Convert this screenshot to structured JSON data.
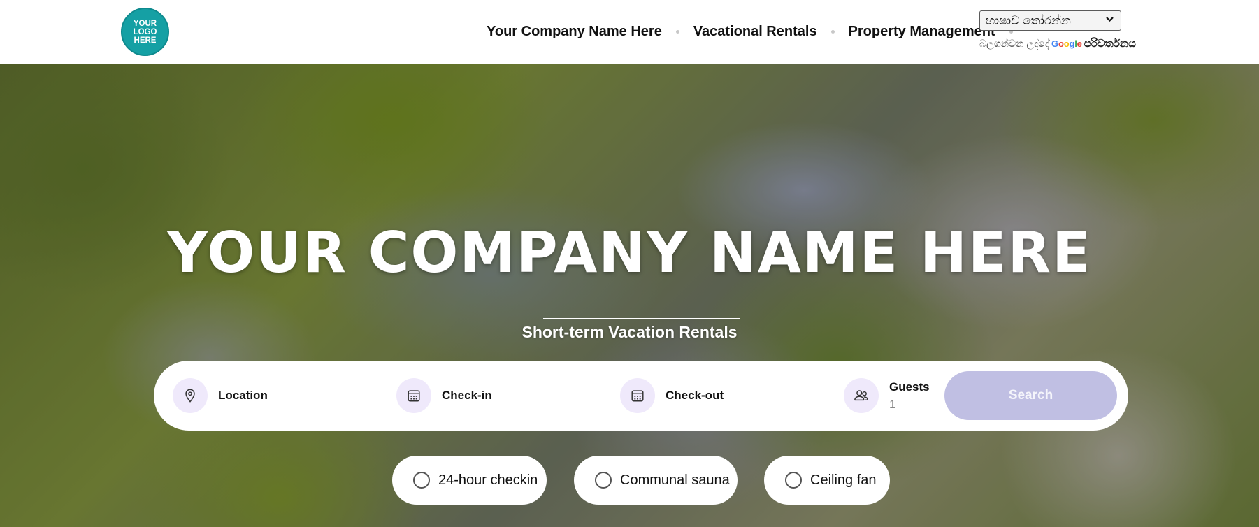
{
  "header": {
    "logo_text": "YOUR LOGO HERE",
    "nav": [
      {
        "label": "Your Company Name Here"
      },
      {
        "label": "Vacational Rentals"
      },
      {
        "label": "Property Management"
      }
    ],
    "language_select": {
      "selected": "භාෂාව තෝරන්න"
    },
    "powered_by": {
      "prefix": "බලගන්වන ලද්දේ",
      "google": "Google",
      "translate": "පරිවර්තනය"
    }
  },
  "hero": {
    "title": "YOUR COMPANY NAME HERE",
    "subtitle": "Short-term Vacation Rentals"
  },
  "search": {
    "location_label": "Location",
    "checkin_label": "Check-in",
    "checkout_label": "Check-out",
    "guests_label": "Guests",
    "guests_value": "1",
    "button_label": "Search"
  },
  "amenities": [
    {
      "label": "24-hour checkin"
    },
    {
      "label": "Communal sauna"
    },
    {
      "label": "Ceiling fan"
    }
  ],
  "colors": {
    "logo": "#15a0a4",
    "search_button": "#c0bfe3",
    "icon_bg": "#efe9fb"
  },
  "icons": [
    "map-pin-icon",
    "calendar-icon",
    "users-icon",
    "chevron-down-icon",
    "radio-icon"
  ]
}
